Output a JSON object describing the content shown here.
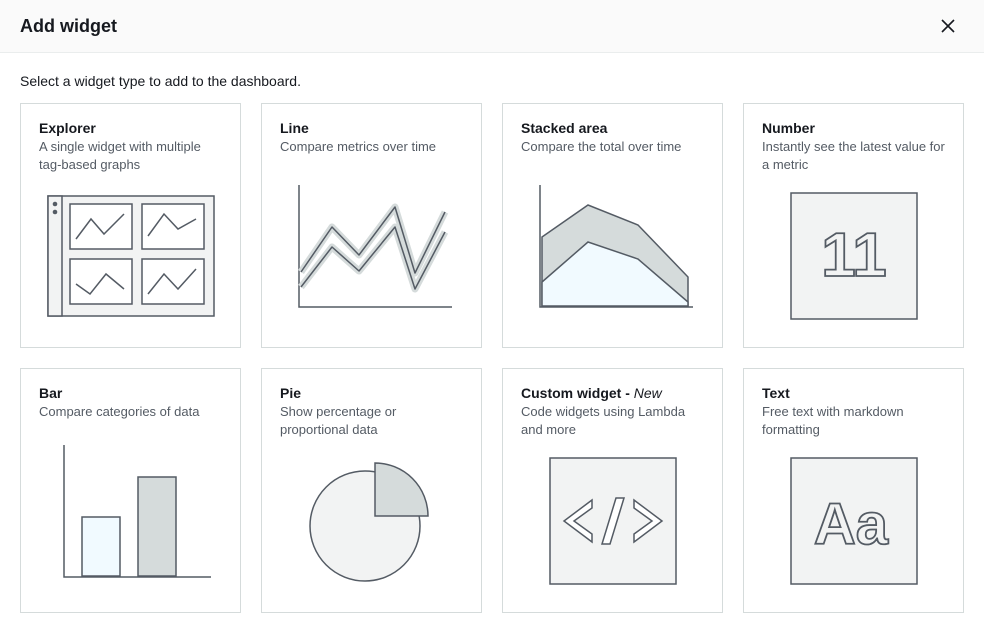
{
  "header": {
    "title": "Add widget"
  },
  "instruction": "Select a widget type to add to the dashboard.",
  "widgets": [
    {
      "title": "Explorer",
      "desc": "A single widget with multiple tag-based graphs",
      "new": ""
    },
    {
      "title": "Line",
      "desc": "Compare metrics over time",
      "new": ""
    },
    {
      "title": "Stacked area",
      "desc": "Compare the total over time",
      "new": ""
    },
    {
      "title": "Number",
      "desc": "Instantly see the latest value for a metric",
      "new": ""
    },
    {
      "title": "Bar",
      "desc": "Compare categories of data",
      "new": ""
    },
    {
      "title": "Pie",
      "desc": "Show percentage or proportional data",
      "new": ""
    },
    {
      "title": "Custom widget - ",
      "desc": "Code widgets using Lambda and more",
      "new": "New"
    },
    {
      "title": "Text",
      "desc": "Free text with markdown formatting",
      "new": ""
    }
  ]
}
